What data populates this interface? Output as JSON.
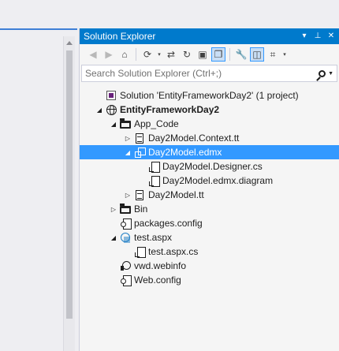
{
  "panel": {
    "title": "Solution Explorer",
    "title_buttons": [
      "▾",
      "⊥",
      "✕"
    ]
  },
  "toolbar": {
    "icons": [
      {
        "name": "back-icon",
        "glyph": "◀",
        "state": "disabled"
      },
      {
        "name": "forward-icon",
        "glyph": "▶",
        "state": "disabled"
      },
      {
        "name": "home-icon",
        "glyph": "⌂",
        "state": "normal"
      },
      {
        "name": "pending-changes-filter-icon",
        "glyph": "⟳",
        "state": "normal",
        "dropdown": true
      },
      {
        "name": "sync-with-active-document-icon",
        "glyph": "⇄",
        "state": "normal"
      },
      {
        "name": "refresh-icon",
        "glyph": "↻",
        "state": "normal"
      },
      {
        "name": "collapse-all-icon",
        "glyph": "▣",
        "state": "normal"
      },
      {
        "name": "show-all-files-icon",
        "glyph": "❐",
        "state": "pressed"
      },
      {
        "name": "properties-icon",
        "glyph": "🔧",
        "state": "normal"
      },
      {
        "name": "preview-selected-items-icon",
        "glyph": "◫",
        "state": "pressed"
      },
      {
        "name": "view-class-diagram-icon",
        "glyph": "⌗",
        "state": "normal",
        "dropdown": true
      }
    ]
  },
  "search": {
    "placeholder": "Search Solution Explorer (Ctrl+;)"
  },
  "tree": [
    {
      "indent": 0,
      "expander": "",
      "icon": "i-sln",
      "icon_name": "solution-icon",
      "label": "Solution 'EntityFrameworkDay2' (1 project)",
      "bold": false,
      "selected": false
    },
    {
      "indent": 0,
      "expander": "◢",
      "icon": "i-web",
      "icon_name": "website-icon",
      "label": "EntityFrameworkDay2",
      "bold": true,
      "selected": false
    },
    {
      "indent": 1,
      "expander": "◢",
      "icon": "i-folder",
      "icon_name": "folder-icon",
      "label": "App_Code",
      "bold": false,
      "selected": false
    },
    {
      "indent": 2,
      "expander": "▷",
      "icon": "i-file",
      "icon_name": "tt-file-icon",
      "label": "Day2Model.Context.tt",
      "bold": false,
      "selected": false
    },
    {
      "indent": 2,
      "expander": "◢",
      "icon": "i-edmx",
      "icon_name": "edmx-file-icon",
      "label": "Day2Model.edmx",
      "bold": false,
      "selected": true
    },
    {
      "indent": 3,
      "expander": "",
      "icon": "i-cs",
      "icon_name": "cs-file-icon",
      "label": "Day2Model.Designer.cs",
      "bold": false,
      "selected": false
    },
    {
      "indent": 3,
      "expander": "",
      "icon": "i-cs",
      "icon_name": "diagram-file-icon",
      "label": "Day2Model.edmx.diagram",
      "bold": false,
      "selected": false
    },
    {
      "indent": 2,
      "expander": "▷",
      "icon": "i-file",
      "icon_name": "tt-file-icon",
      "label": "Day2Model.tt",
      "bold": false,
      "selected": false
    },
    {
      "indent": 1,
      "expander": "▷",
      "icon": "i-folder",
      "icon_name": "folder-icon",
      "label": "Bin",
      "bold": false,
      "selected": false
    },
    {
      "indent": 1,
      "expander": "",
      "icon": "i-cfg",
      "icon_name": "config-file-icon",
      "label": "packages.config",
      "bold": false,
      "selected": false
    },
    {
      "indent": 1,
      "expander": "◢",
      "icon": "i-aspx",
      "icon_name": "aspx-file-icon",
      "label": "test.aspx",
      "bold": false,
      "selected": false
    },
    {
      "indent": 2,
      "expander": "",
      "icon": "i-cs",
      "icon_name": "cs-file-icon",
      "label": "test.aspx.cs",
      "bold": false,
      "selected": false
    },
    {
      "indent": 1,
      "expander": "",
      "icon": "i-vwd",
      "icon_name": "webinfo-file-icon",
      "label": "vwd.webinfo",
      "bold": false,
      "selected": false
    },
    {
      "indent": 1,
      "expander": "",
      "icon": "i-cfg",
      "icon_name": "config-file-icon",
      "label": "Web.config",
      "bold": false,
      "selected": false
    }
  ],
  "colors": {
    "accent": "#007acc",
    "selection": "#3399ff",
    "panel_bg": "#f5f5f5"
  }
}
